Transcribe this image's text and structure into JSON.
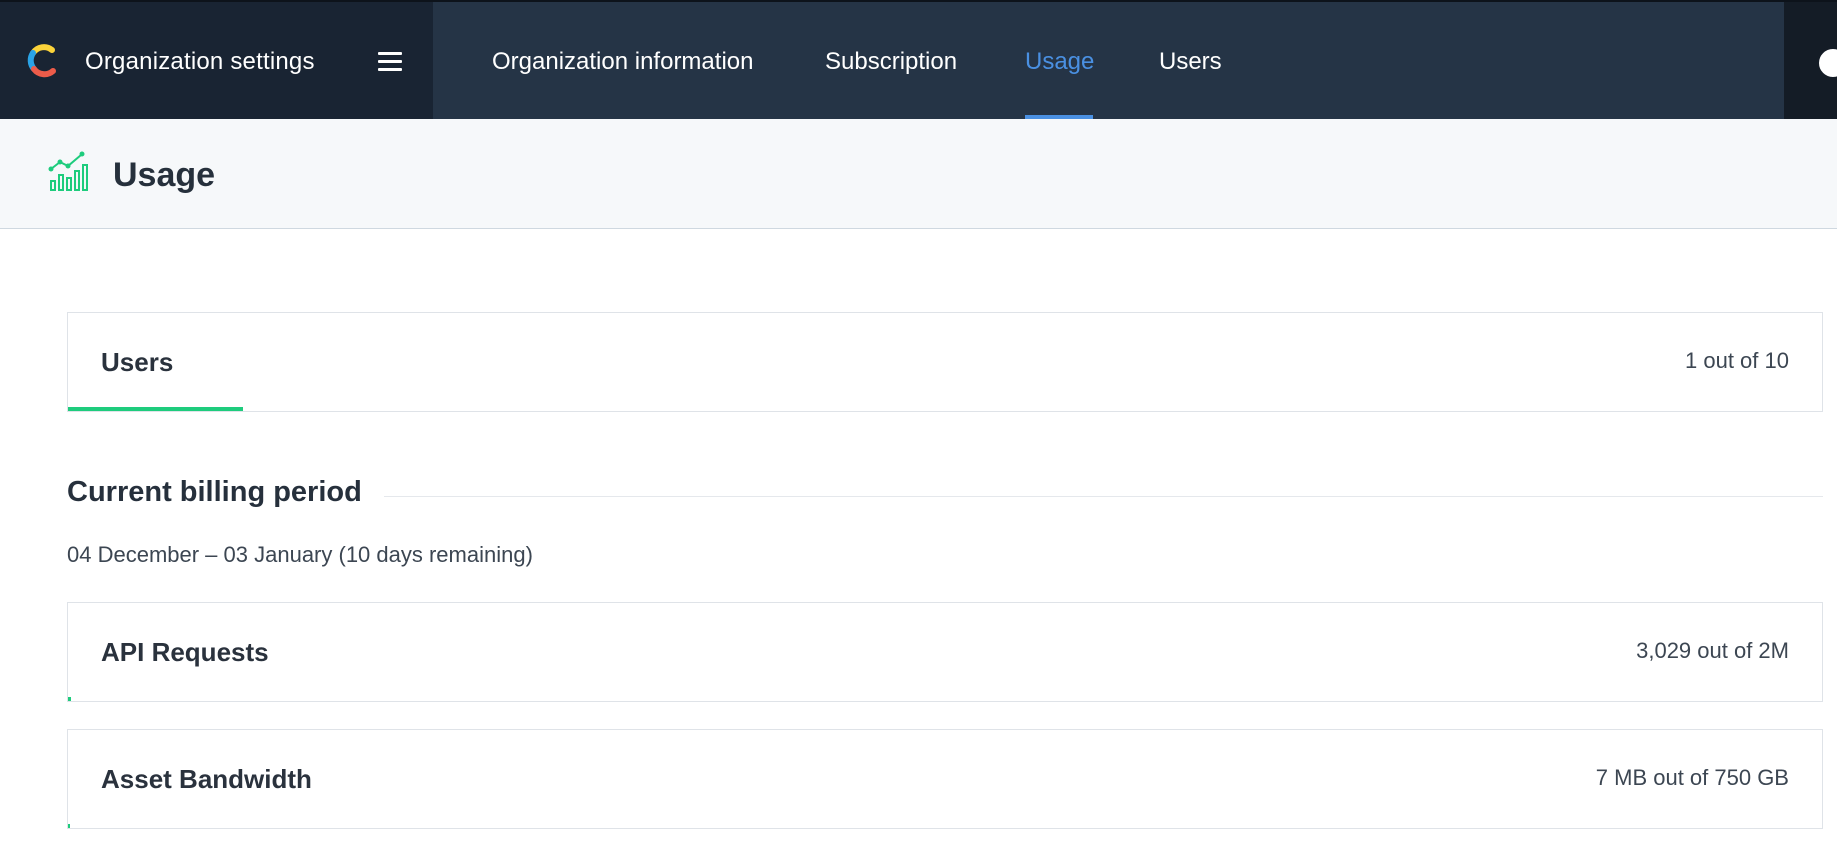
{
  "header": {
    "brand_title": "Organization settings",
    "menu_icon": "hamburger-menu-icon",
    "logo_icon": "contentful-logo-icon",
    "nav": [
      {
        "label": "Organization information",
        "active": false
      },
      {
        "label": "Subscription",
        "active": false
      },
      {
        "label": "Usage",
        "active": true
      },
      {
        "label": "Users",
        "active": false
      }
    ],
    "accent_color": "#4a90e2"
  },
  "page": {
    "title": "Usage",
    "icon": "usage-chart-icon"
  },
  "users_card": {
    "label": "Users",
    "value": "1 out of 10",
    "progress": 0.1
  },
  "billing": {
    "section_title": "Current billing period",
    "range": "04 December – 03 January (10 days remaining)"
  },
  "api_card": {
    "label": "API Requests",
    "value": "3,029 out of 2M",
    "progress": 0.0015
  },
  "bandwidth_card": {
    "label": "Asset Bandwidth",
    "value": "7 MB out of 750 GB",
    "progress": 1e-05
  },
  "colors": {
    "progress": "#1ecc7d",
    "topbar": "#253446",
    "brand_bg": "#192433"
  }
}
